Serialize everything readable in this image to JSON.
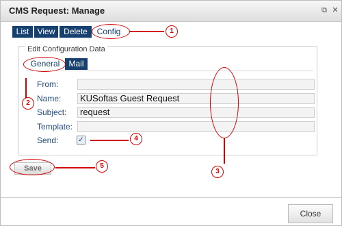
{
  "window": {
    "title": "CMS Request: Manage",
    "popout_icon": "popout-icon",
    "close_icon": "close-icon"
  },
  "tabs": [
    {
      "label": "List"
    },
    {
      "label": "View"
    },
    {
      "label": "Delete"
    },
    {
      "label": "Config"
    }
  ],
  "group": {
    "legend": "Edit Configuration Data",
    "subtabs": [
      {
        "label": "General"
      },
      {
        "label": "Mail"
      }
    ]
  },
  "form": {
    "fields": [
      {
        "label": "From:",
        "value": ""
      },
      {
        "label": "Name:",
        "value": "KUSoftas Guest Request"
      },
      {
        "label": "Subject:",
        "value": "request"
      },
      {
        "label": "Template:",
        "value": ""
      }
    ],
    "send": {
      "label": "Send:",
      "checked": true,
      "check_glyph": "✓"
    }
  },
  "actions": {
    "save_label": "Save",
    "close_label": "Close"
  },
  "annotations": {
    "numbers": [
      "1",
      "2",
      "3",
      "4",
      "5"
    ],
    "color": "#d40000"
  },
  "colors": {
    "tab_bg": "#16406e",
    "label_text": "#1f4a7a"
  }
}
